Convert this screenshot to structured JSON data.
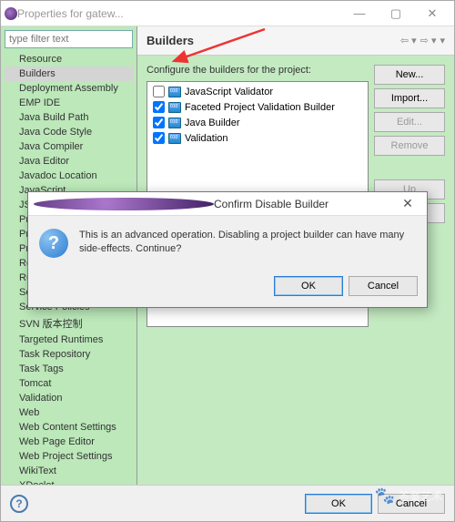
{
  "window": {
    "title": "Properties for gatew..."
  },
  "filter_placeholder": "type filter text",
  "tree": [
    "Resource",
    "Builders",
    "Deployment Assembly",
    "EMP IDE",
    "Java Build Path",
    "Java Code Style",
    "Java Compiler",
    "Java Editor",
    "Javadoc Location",
    "JavaScript",
    "JSP...",
    "Pro...",
    "Pro...",
    "Pro...",
    "Ref...",
    "Run...",
    "Ser...",
    "Service Policies",
    "SVN 版本控制",
    "Targeted Runtimes",
    "Task Repository",
    "Task Tags",
    "Tomcat",
    "Validation",
    "Web",
    "Web Content Settings",
    "Web Page Editor",
    "Web Project Settings",
    "WikiText",
    "XDoclet"
  ],
  "selected_tree_index": 1,
  "main": {
    "heading": "Builders",
    "desc": "Configure the builders for the project:",
    "builders": [
      {
        "label": "JavaScript Validator",
        "checked": false
      },
      {
        "label": "Faceted Project Validation Builder",
        "checked": true
      },
      {
        "label": "Java Builder",
        "checked": true
      },
      {
        "label": "Validation",
        "checked": true
      }
    ],
    "buttons": {
      "new": "New...",
      "import": "Import...",
      "edit": "Edit...",
      "remove": "Remove",
      "up": "Up",
      "down": "Down"
    }
  },
  "bottom": {
    "ok": "OK",
    "cancel": "Cancel"
  },
  "dialog": {
    "title": "Confirm Disable Builder",
    "message": "This is an advanced operation. Disabling a project builder can have many side-effects. Continue?",
    "ok": "OK",
    "cancel": "Cancel"
  },
  "watermark": "答案艺术"
}
